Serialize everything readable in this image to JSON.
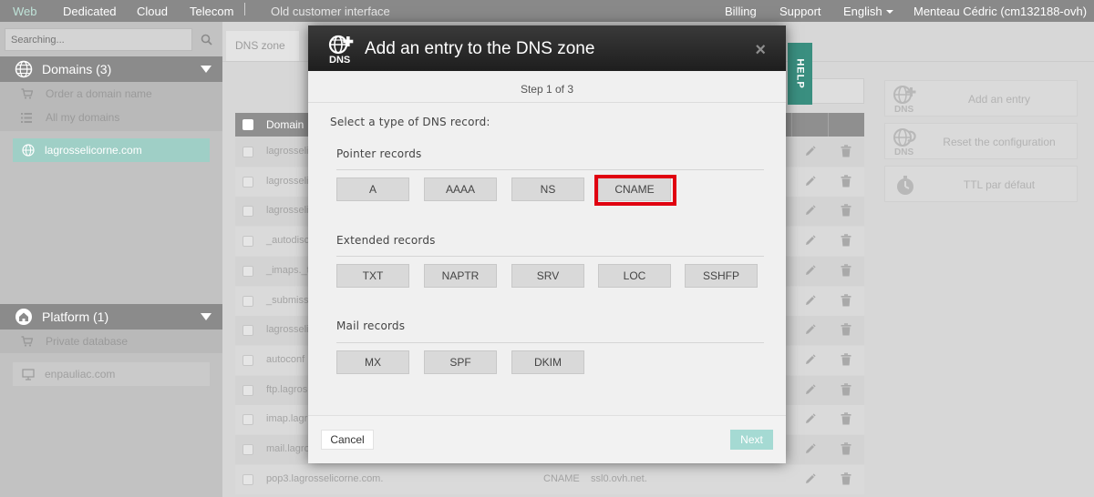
{
  "topnav": {
    "items": [
      "Web",
      "Dedicated",
      "Cloud",
      "Telecom"
    ],
    "old_interface": "Old customer interface",
    "billing": "Billing",
    "support": "Support",
    "language": "English",
    "account": "Menteau Cédric (cm132188-ovh)"
  },
  "sidebar": {
    "search_placeholder": "Searching...",
    "domains_title": "Domains (3)",
    "order_domain": "Order a domain name",
    "all_domains": "All my domains",
    "selected_domain": "lagrosselicorne.com",
    "platform_title": "Platform (1)",
    "private_db": "Private database",
    "platform_domain": "enpauliac.com"
  },
  "main": {
    "tab_label": "DNS zone",
    "col_domain": "Domain",
    "rows": [
      {
        "domain": "lagrosseli",
        "type": "",
        "target": ""
      },
      {
        "domain": "lagrosseli",
        "type": "",
        "target": ""
      },
      {
        "domain": "lagrosseli",
        "type": "",
        "target": ""
      },
      {
        "domain": "_autodisc",
        "type": "",
        "target": ""
      },
      {
        "domain": "_imaps._t",
        "type": "",
        "target": ""
      },
      {
        "domain": "_submissi",
        "type": "",
        "target": ""
      },
      {
        "domain": "lagrosseli",
        "type": "",
        "target": ""
      },
      {
        "domain": "autoconf",
        "type": "",
        "target": ""
      },
      {
        "domain": "ftp.lagros",
        "type": "",
        "target": ""
      },
      {
        "domain": "imap.lagr",
        "type": "",
        "target": ""
      },
      {
        "domain": "mail.lagro",
        "type": "",
        "target": ""
      },
      {
        "domain": "pop3.lagrosselicorne.com.",
        "type": "CNAME",
        "target": "ssl0.ovh.net."
      }
    ],
    "right_panel": {
      "add_entry": "Add an entry",
      "reset_config": "Reset the configuration",
      "ttl_default": "TTL par défaut"
    },
    "help_label": "HELP"
  },
  "modal": {
    "title": "Add an entry to the DNS zone",
    "close": "×",
    "step": "Step 1 of 3",
    "intro": "Select a type of DNS record:",
    "groups": [
      {
        "title": "Pointer records",
        "buttons": [
          "A",
          "AAAA",
          "NS",
          "CNAME"
        ]
      },
      {
        "title": "Extended records",
        "buttons": [
          "TXT",
          "NAPTR",
          "SRV",
          "LOC",
          "SSHFP"
        ]
      },
      {
        "title": "Mail records",
        "buttons": [
          "MX",
          "SPF",
          "DKIM"
        ]
      }
    ],
    "highlighted_button": "CNAME",
    "highlight_color": "#e00010",
    "cancel": "Cancel",
    "next": "Next"
  },
  "colors": {
    "accent": "#3a8f80",
    "next_button": "#a5dad3",
    "active_nav": "#bfe3d8"
  }
}
